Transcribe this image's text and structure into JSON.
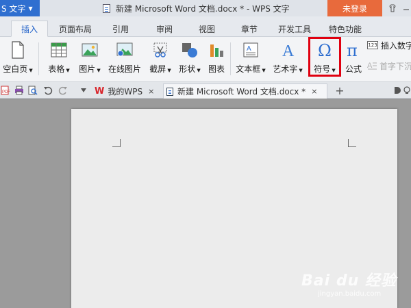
{
  "titlebar": {
    "app_menu_label": "S 文字",
    "doc_title": "新建 Microsoft Word 文档.docx * - WPS 文字",
    "login_label": "未登录"
  },
  "menu_tabs": [
    "插入",
    "页面布局",
    "引用",
    "审阅",
    "视图",
    "章节",
    "开发工具",
    "特色功能"
  ],
  "active_tab": "插入",
  "ribbon": {
    "blank_page": "空白页",
    "table": "表格",
    "picture": "图片",
    "online_picture": "在线图片",
    "screenshot": "截屏",
    "shape": "形状",
    "chart": "图表",
    "textbox": "文本框",
    "wordart": "艺术字",
    "symbol": "符号",
    "formula": "公式",
    "insert_number": "插入数字",
    "insert_number_icon": "123",
    "drop_cap": "首字下沉"
  },
  "doc_tabs": [
    {
      "label": "我的WPS",
      "close": "×"
    },
    {
      "label": "新建 Microsoft Word 文档.docx *",
      "close": "×"
    }
  ],
  "new_tab_label": "+",
  "watermark": {
    "line1": "Bai du 经验",
    "line2": "jingyan.baidu.com"
  },
  "colors": {
    "app_menu": "#2f6fd0",
    "login_button": "#e86a3c",
    "highlight_box": "#e00010",
    "active_tab_text": "#1e5fc8"
  }
}
